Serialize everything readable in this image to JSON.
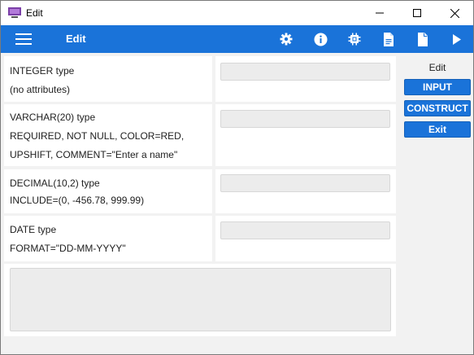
{
  "window": {
    "title": "Edit"
  },
  "toolbar": {
    "title": "Edit",
    "icons": [
      "menu-icon",
      "gear-icon",
      "info-icon",
      "chip-icon",
      "document-lines-icon",
      "document-icon",
      "play-icon"
    ]
  },
  "fields": [
    {
      "line1": "INTEGER type",
      "line2": "(no attributes)",
      "line3": "",
      "value": ""
    },
    {
      "line1": "VARCHAR(20) type",
      "line2": "REQUIRED, NOT NULL, COLOR=RED,",
      "line3": "UPSHIFT, COMMENT=\"Enter a name\"",
      "value": ""
    },
    {
      "line1": "DECIMAL(10,2) type",
      "line2": "INCLUDE=(0, -456.78, 999.99)",
      "line3": "",
      "value": ""
    },
    {
      "line1": "DATE type",
      "line2": "FORMAT=\"DD-MM-YYYY\"",
      "line3": "",
      "value": ""
    }
  ],
  "sidepanel": {
    "title": "Edit",
    "buttons": [
      "INPUT",
      "CONSTRUCT",
      "Exit"
    ]
  },
  "colors": {
    "accent": "#1a73d9",
    "field_bg": "#ececec",
    "window_bg": "#f2f2f2"
  }
}
